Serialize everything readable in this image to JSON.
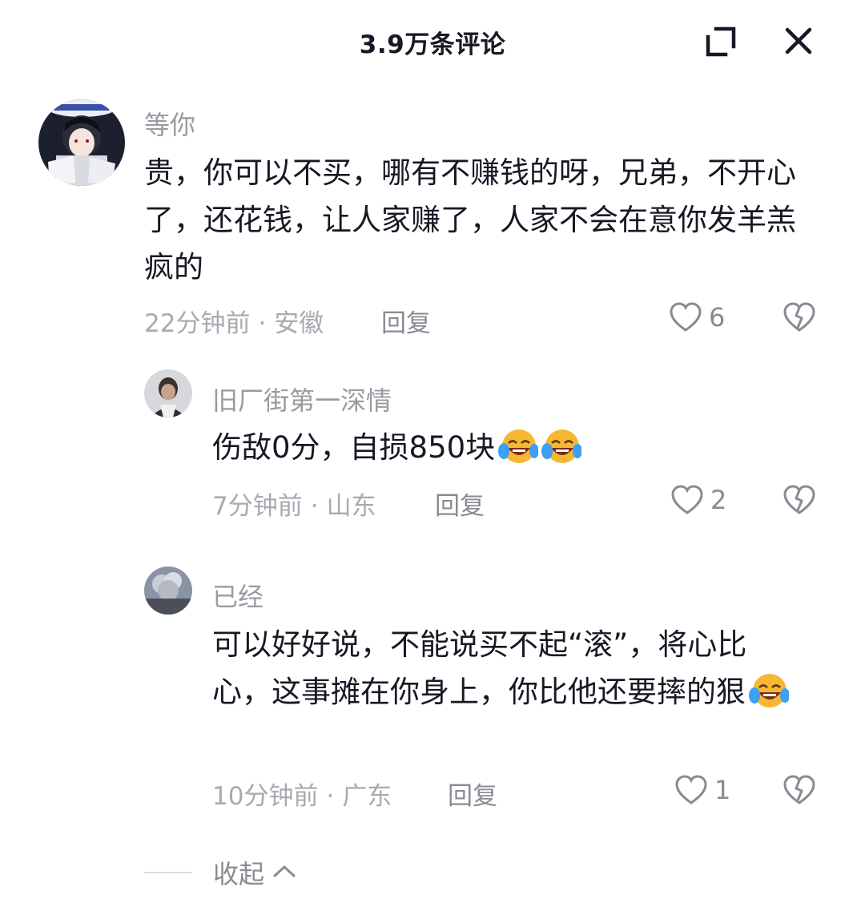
{
  "header": {
    "title": "3.9万条评论",
    "expand_icon": "expand-icon",
    "close_icon": "close-icon"
  },
  "comments": [
    {
      "username": "等你",
      "text": "贵，你可以不买，哪有不赚钱的呀，兄弟，不开心了，还花钱，让人家赚了，人家不会在意你发羊羔疯的",
      "time": "22分钟前",
      "location": "安徽",
      "reply_label": "回复",
      "like_count": "6"
    },
    {
      "username": "旧厂街第一深情",
      "text": "伤敌0分，自损850块",
      "emoji_count": 2,
      "emoji": "laughing-crying-emoji",
      "time": "7分钟前",
      "location": "山东",
      "reply_label": "回复",
      "like_count": "2"
    },
    {
      "username": "已经",
      "text": "可以好好说，不能说买不起“滚”，将心比心，这事摊在你身上，你比他还要摔的狠",
      "emoji_count": 1,
      "emoji": "laughing-crying-emoji",
      "time": "10分钟前",
      "location": "广东",
      "reply_label": "回复",
      "like_count": "1"
    }
  ],
  "meta_separator": "·",
  "collapse": {
    "label": "收起"
  },
  "colors": {
    "text": "#161823",
    "secondary": "#9a9aa2",
    "icon": "#8a8a93",
    "emoji_face": "#f7b733"
  }
}
